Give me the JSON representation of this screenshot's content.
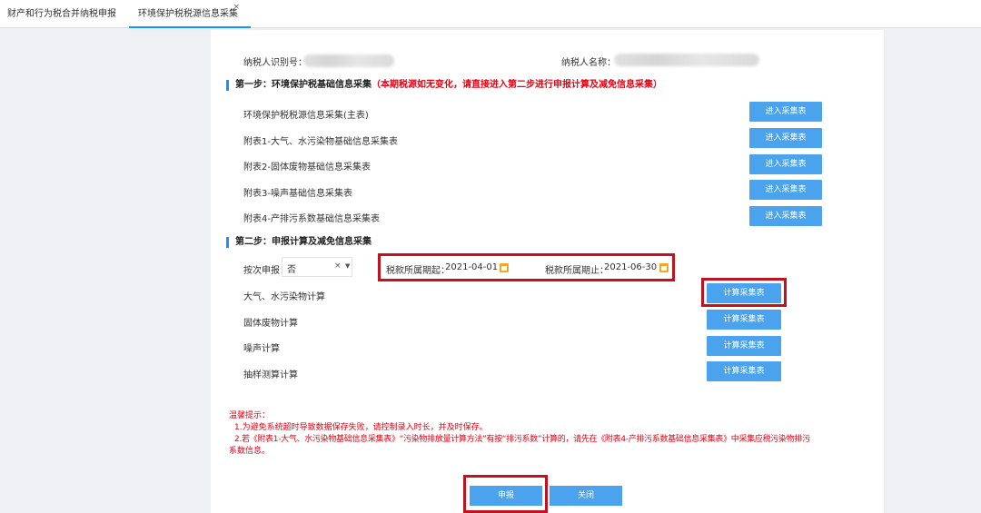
{
  "tabs": [
    {
      "label": "财产和行为税合并纳税申报"
    },
    {
      "label": "环境保护税税源信息采集",
      "close": "×"
    }
  ],
  "taxpayer": {
    "id_label": "纳税人识别号：",
    "name_label": "纳税人名称："
  },
  "step1": {
    "title": "第一步：环境保护税基础信息采集",
    "note": "（本期税源如无变化，请直接进入第二步进行申报计算及减免信息采集）",
    "rows": [
      {
        "label": "环境保护税税源信息采集(主表)",
        "button": "进入采集表"
      },
      {
        "label": "附表1-大气、水污染物基础信息采集表",
        "button": "进入采集表"
      },
      {
        "label": "附表2-固体废物基础信息采集表",
        "button": "进入采集表"
      },
      {
        "label": "附表3-噪声基础信息采集表",
        "button": "进入采集表"
      },
      {
        "label": "附表4-产排污系数基础信息采集表",
        "button": "进入采集表"
      }
    ]
  },
  "step2": {
    "title": "第二步：申报计算及减免信息采集",
    "per_time_label": "按次申报：",
    "per_time_value": "否",
    "clear": "×",
    "dropdown": "▼",
    "period_start_label": "税款所属期起：",
    "period_start": "2021-04-01",
    "period_end_label": "税款所属期止：",
    "period_end": "2021-06-30",
    "rows": [
      {
        "label": "大气、水污染物计算",
        "button": "计算采集表"
      },
      {
        "label": "固体废物计算",
        "button": "计算采集表"
      },
      {
        "label": "噪声计算",
        "button": "计算采集表"
      },
      {
        "label": "抽样测算计算",
        "button": "计算采集表"
      }
    ]
  },
  "tips": {
    "title": "温馨提示：",
    "line1": "1.为避免系统超时导致数据保存失败，请控制录入时长，并及时保存。",
    "line2a": "2.若《附表1-大气、水污染物基础信息采集表》“污染物排放量计算方法”有按“排污系数”计算的，请先在《附表4-产排污系数基础信息采集表》中采集应税污染物排污",
    "line2b": "系数信息。"
  },
  "footer": {
    "submit": "申报",
    "close": "关闭"
  },
  "colors": {
    "primary_button": "#4aa3ec",
    "highlight_border": "#c1121f",
    "warning_text": "#e60012",
    "section_marker": "#1890ff"
  }
}
